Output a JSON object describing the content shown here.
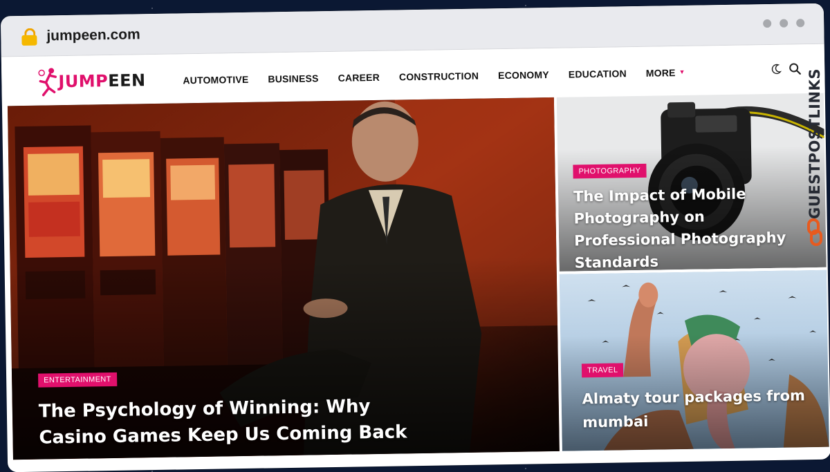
{
  "browser": {
    "url": "jumpeen.com"
  },
  "site": {
    "logo_text_accent": "JUMP",
    "logo_text_rest": "EEN",
    "brand_color": "#e0106c",
    "nav": [
      {
        "label": "AUTOMOTIVE"
      },
      {
        "label": "BUSINESS"
      },
      {
        "label": "CAREER"
      },
      {
        "label": "CONSTRUCTION"
      },
      {
        "label": "ECONOMY"
      },
      {
        "label": "EDUCATION"
      },
      {
        "label": "MORE"
      }
    ],
    "icons": [
      "moon-icon",
      "search-icon",
      "chevron-down-icon",
      "lock-icon"
    ]
  },
  "featured": {
    "main": {
      "category": "ENTERTAINMENT",
      "title": "The Psychology of Winning: Why Casino Games Keep Us Coming Back"
    },
    "top_right": {
      "category": "PHOTOGRAPHY",
      "title": "The Impact of Mobile Photography on Professional Photography Standards"
    },
    "bottom_right": {
      "category": "TRAVEL",
      "title": "Almaty tour packages from mumbai"
    }
  },
  "watermark": {
    "text": "GUESTPOSTLINKS"
  }
}
